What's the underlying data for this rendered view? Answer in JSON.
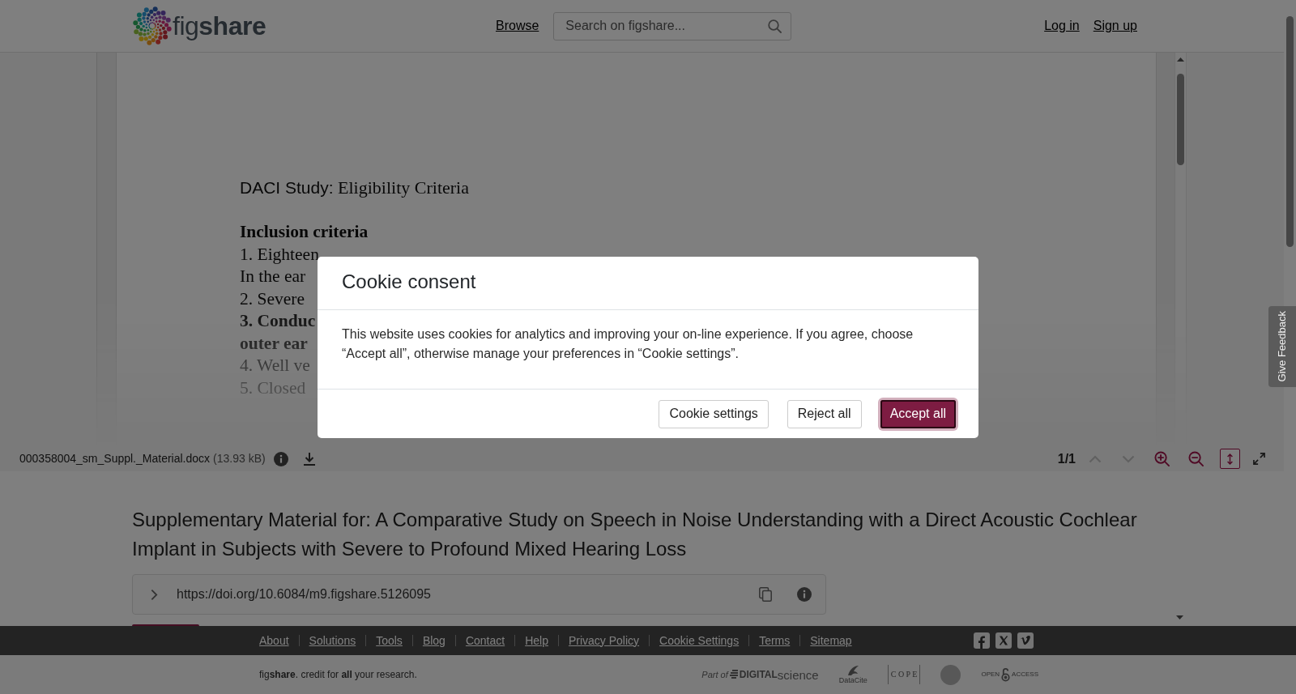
{
  "header": {
    "logo_text": "fig**share**",
    "nav_link": "Browse",
    "search": {
      "placeholder": "Search on figshare..."
    },
    "auth_links": [
      "Log in",
      "Sign up"
    ]
  },
  "document_preview": {
    "title_prefix": "DACI Study:",
    "title": "Eligibility Criteria",
    "lines": [
      {
        "kind": "heading",
        "text": "Inclusion criteria"
      },
      {
        "kind": "plain",
        "text": "1. Eighteen"
      },
      {
        "kind": "plain",
        "text": "In the ear"
      },
      {
        "kind": "plain",
        "text": "2. Severe"
      },
      {
        "kind": "strong",
        "text": "3. Conduc"
      },
      {
        "kind": "strong",
        "text": "outer ear"
      },
      {
        "kind": "plain",
        "text": "4. Well ve"
      },
      {
        "kind": "plain",
        "text": "5. Closed"
      }
    ]
  },
  "viewer_toolbar": {
    "file_name": "000358004_sm_Suppl._Material.docx",
    "file_size": "(13.93 kB)",
    "page_indicator": "1/1",
    "page_nav": [
      {
        "kind": "previous",
        "disabled": true
      },
      {
        "kind": "next",
        "disabled": true
      }
    ],
    "tools": [
      {
        "kind": "zoom-in",
        "selected": false
      },
      {
        "kind": "zoom-out",
        "selected": false
      },
      {
        "kind": "fit-height",
        "selected": true
      },
      {
        "kind": "fullscreen",
        "selected": false
      }
    ]
  },
  "item": {
    "title": "Supplementary Material for: A Comparative Study on Speech in Noise Understanding with a Direct Acoustic Cochlear Implant in Subjects with Severe to Profound Mixed Hearing Loss",
    "doi": "https://doi.org/10.6084/m9.figshare.5126095"
  },
  "footer": {
    "links": [
      "About",
      "Solutions",
      "Tools",
      "Blog",
      "Contact",
      "Help",
      "Privacy Policy",
      "Cookie Settings",
      "Terms",
      "Sitemap"
    ],
    "tagline": "fig**share**. credit for **all** your research.",
    "partner_logos": [
      {
        "kind": "digital-science",
        "texts": [
          "Part of",
          "DIGITAL",
          "science"
        ]
      },
      {
        "kind": "datacite",
        "texts": [
          "DataCite"
        ]
      },
      {
        "kind": "cope",
        "texts": [
          "C O P E"
        ]
      },
      {
        "kind": "seal"
      },
      {
        "kind": "open-access",
        "texts": [
          "OPEN",
          "ACCESS"
        ]
      }
    ]
  },
  "cookie_dialog": {
    "title": "Cookie consent",
    "message": "This website uses cookies for analytics and improving your on-line experience. If you agree, choose “Accept all”, otherwise manage your preferences in “Cookie settings”.",
    "buttons": [
      {
        "label": "Cookie settings",
        "kind": "secondary",
        "focused": false
      },
      {
        "label": "Reject all",
        "kind": "secondary",
        "focused": false
      },
      {
        "label": "Accept all",
        "kind": "primary",
        "focused": true
      }
    ]
  },
  "feedback_tab": {
    "label": "Give Feedback"
  }
}
